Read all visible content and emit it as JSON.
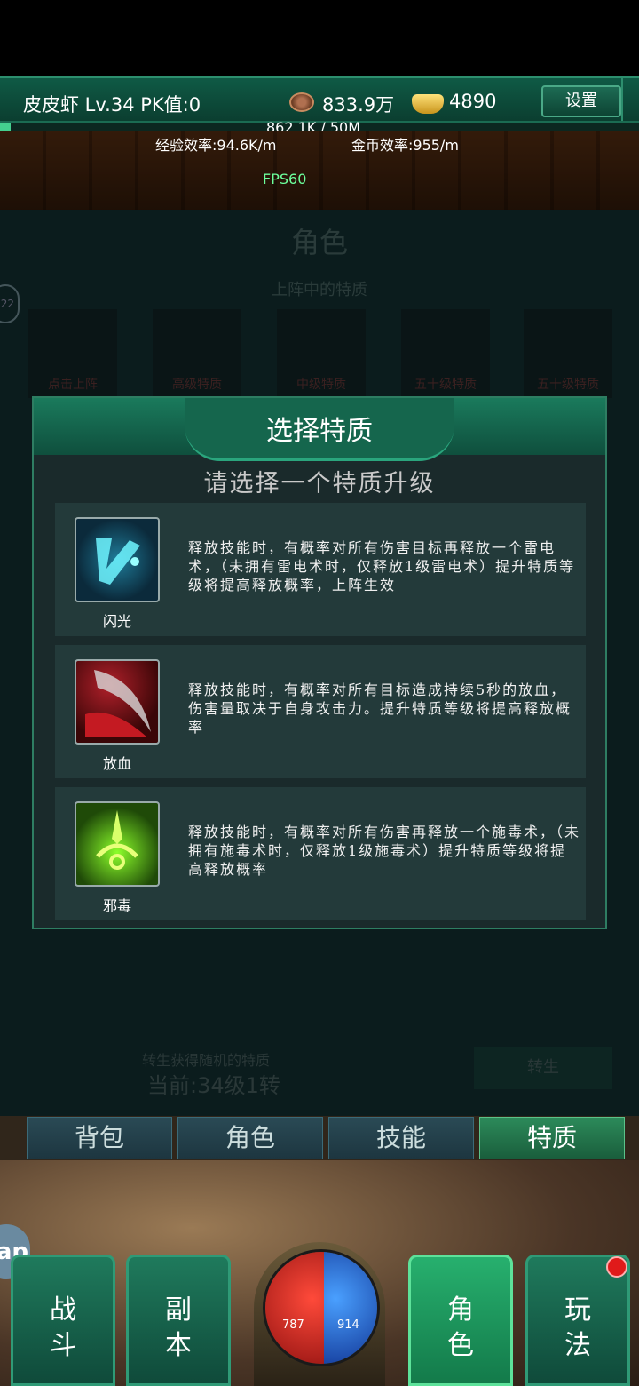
{
  "player": {
    "name_line": "皮皮虾   Lv.34 PK值:0",
    "gold": "833.9万",
    "ingot": "4890",
    "settings_label": "设置",
    "exp_text": "862.1K / 50M",
    "exp_progress": 0.017,
    "exp_rate": "经验效率:94.6K/m",
    "gold_rate": "金币效率:955/m",
    "fps": "FPS60"
  },
  "background_panel": {
    "title": "角色",
    "subtitle": "上阵中的特质",
    "slots": [
      "点击上阵",
      "高级特质",
      "中级特质",
      "五十级特质",
      "五十级特质"
    ],
    "rebirth_hint": "转生获得随机的特质",
    "rebirth_current": "当前:34级1转",
    "rebirth_button": "转生",
    "side_counter": "22"
  },
  "modal": {
    "title": "选择特质",
    "prompt": "请选择一个特质升级",
    "traits": [
      {
        "name": "闪光",
        "icon": "lightning-rune-icon",
        "desc": "释放技能时，有概率对所有伤害目标再释放一个雷电术，（未拥有雷电术时，仅释放1级雷电术）提升特质等级将提高释放概率，上阵生效"
      },
      {
        "name": "放血",
        "icon": "bleeding-claw-icon",
        "desc": "释放技能时，有概率对所有目标造成持续5秒的放血，伤害量取决于自身攻击力。提升特质等级将提高释放概率"
      },
      {
        "name": "邪毒",
        "icon": "poison-sigil-icon",
        "desc": "释放技能时，有概率对所有伤害再释放一个施毒术，（未拥有施毒术时，仅释放1级施毒术）提升特质等级将提高释放概率"
      }
    ]
  },
  "tabs": [
    {
      "label": "背包",
      "active": false
    },
    {
      "label": "角色",
      "active": false
    },
    {
      "label": "技能",
      "active": false
    },
    {
      "label": "特质",
      "active": true
    }
  ],
  "bottom_nav": {
    "battle": "战斗",
    "dungeon": "副本",
    "character": "角色",
    "play": "玩法",
    "hp": "787",
    "mp": "914",
    "app_bubble": "ap"
  }
}
